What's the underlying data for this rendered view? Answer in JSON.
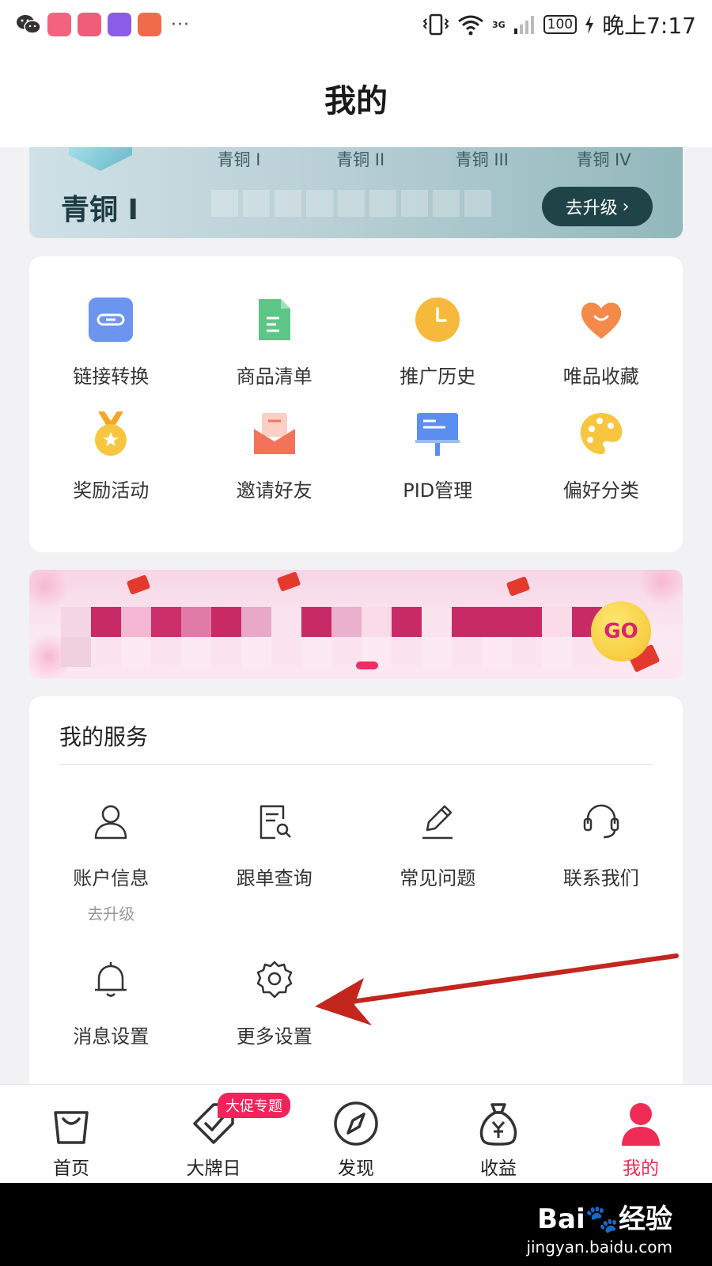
{
  "status_bar": {
    "time": "晚上7:17",
    "battery": "100",
    "network": "3G",
    "overflow": "···",
    "apps": [
      {
        "name": "app-icon-1",
        "color": "#f3627f"
      },
      {
        "name": "app-icon-2",
        "color": "#ef5d7a"
      },
      {
        "name": "app-icon-3",
        "color": "#8a5ce8"
      },
      {
        "name": "app-icon-4",
        "color": "#f06b4a"
      }
    ]
  },
  "header": {
    "title": "我的"
  },
  "level": {
    "tabs": [
      "青铜 I",
      "青铜 II",
      "青铜 III",
      "青铜 IV"
    ],
    "current": "青铜 I",
    "upgrade_label": "去升级",
    "upgrade_arrow": "›"
  },
  "tools": [
    {
      "label": "链接转换",
      "icon": "link-icon"
    },
    {
      "label": "商品清单",
      "icon": "document-icon"
    },
    {
      "label": "推广历史",
      "icon": "clock-icon"
    },
    {
      "label": "唯品收藏",
      "icon": "heart-icon"
    },
    {
      "label": "奖励活动",
      "icon": "medal-icon"
    },
    {
      "label": "邀请好友",
      "icon": "envelope-icon"
    },
    {
      "label": "PID管理",
      "icon": "billboard-icon"
    },
    {
      "label": "偏好分类",
      "icon": "palette-icon"
    }
  ],
  "banner": {
    "go_label": "GO"
  },
  "services": {
    "title": "我的服务",
    "items": [
      {
        "label": "账户信息",
        "sub": "去升级",
        "icon": "user-icon"
      },
      {
        "label": "跟单查询",
        "sub": "",
        "icon": "search-doc-icon"
      },
      {
        "label": "常见问题",
        "sub": "",
        "icon": "pencil-icon"
      },
      {
        "label": "联系我们",
        "sub": "",
        "icon": "headset-icon"
      },
      {
        "label": "消息设置",
        "sub": "",
        "icon": "bell-icon"
      },
      {
        "label": "更多设置",
        "sub": "",
        "icon": "gear-icon"
      }
    ]
  },
  "bottom_nav": {
    "items": [
      {
        "label": "首页",
        "icon": "shopping-bag-icon"
      },
      {
        "label": "大牌日",
        "icon": "tag-check-icon"
      },
      {
        "label": "发现",
        "icon": "compass-icon"
      },
      {
        "label": "收益",
        "icon": "money-bag-icon"
      },
      {
        "label": "我的",
        "icon": "person-icon"
      }
    ],
    "promo_badge": "大促专题",
    "active_color": "#ef2c55"
  },
  "watermark": {
    "logo": "Bai🐾经验",
    "url": "jingyan.baidu.com"
  }
}
